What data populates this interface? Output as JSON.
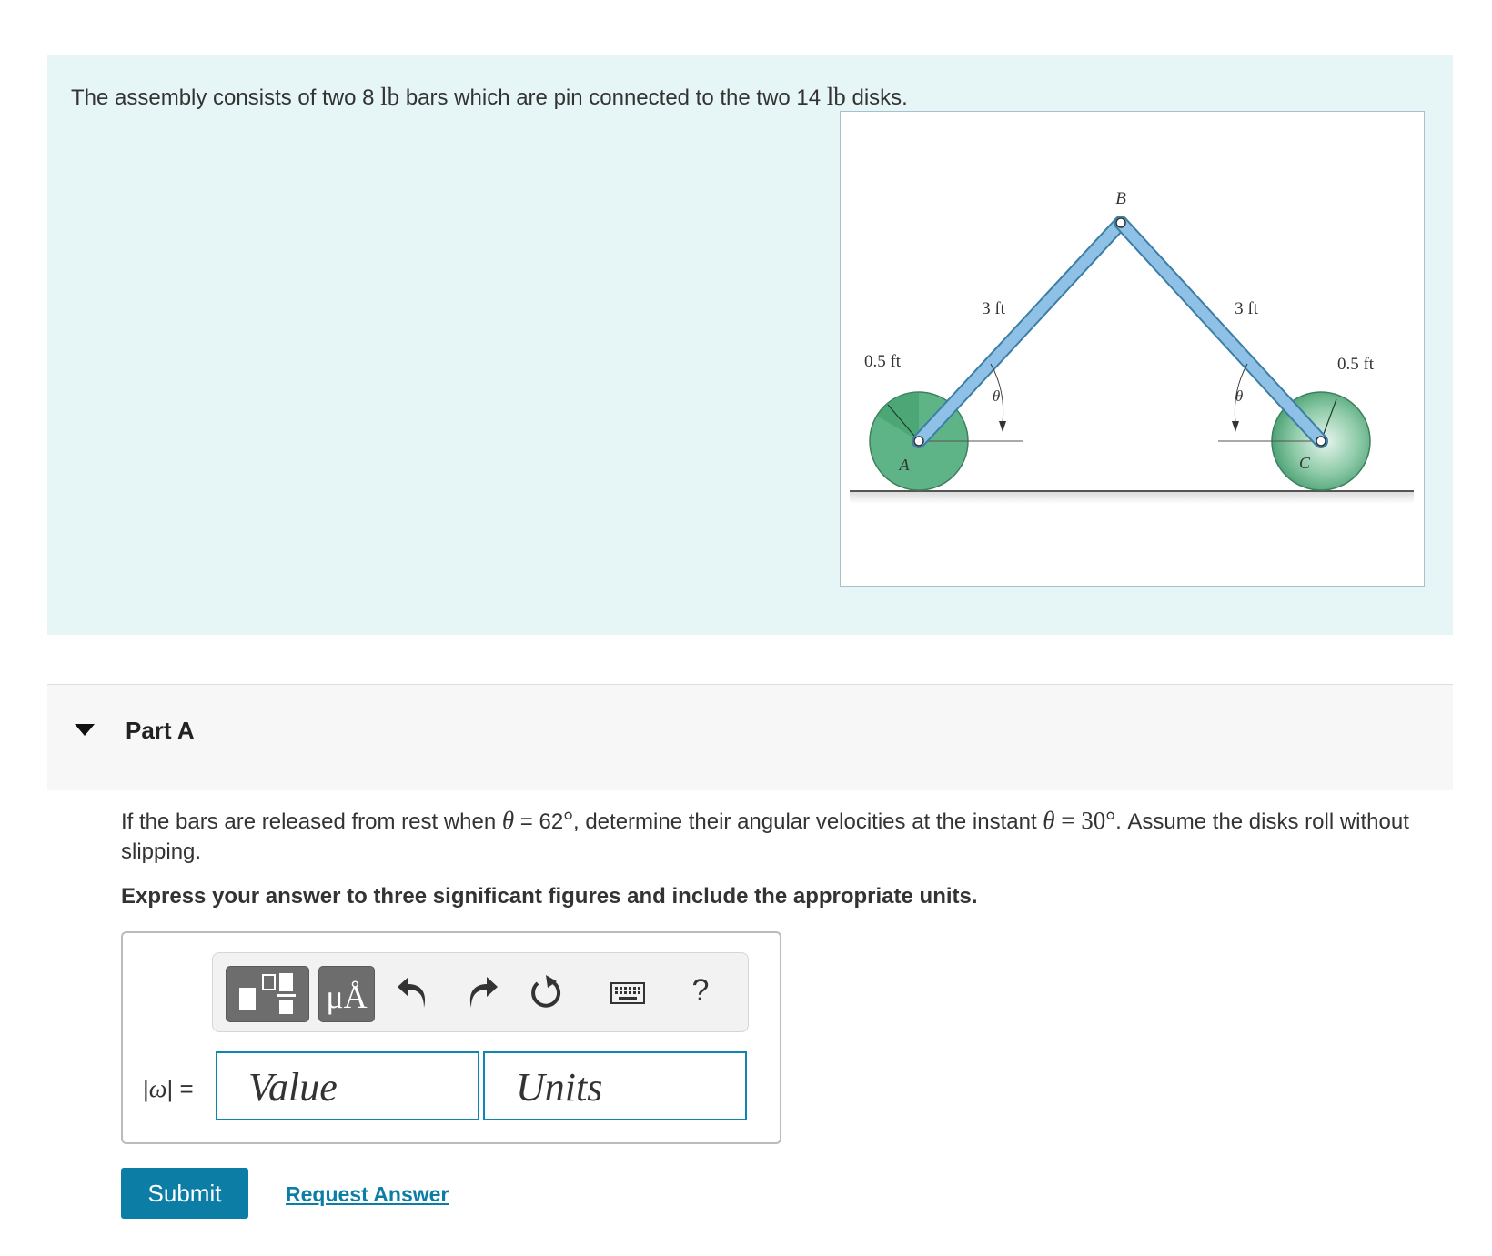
{
  "problem": {
    "intro_before_bar_weight": "The assembly consists of two 8 ",
    "bar_weight_unit": "lb",
    "intro_middle": " bars which are pin connected to the two 14 ",
    "disk_weight_unit": "lb",
    "intro_end": " disks.",
    "figure": {
      "label_B": "B",
      "label_A": "A",
      "label_C": "C",
      "label_bar_left_length": "3 ft",
      "label_bar_right_length": "3 ft",
      "label_disk_left_radius": "0.5 ft",
      "label_disk_right_radius": "0.5 ft",
      "label_theta_left": "θ",
      "label_theta_right": "θ",
      "bar_color": "#8fc1e6",
      "disk_color": "#5fb487"
    }
  },
  "part": {
    "title": "Part A",
    "question_pre": "If the bars are released from rest when ",
    "theta_symbol": "θ",
    "initial_angle": " = 62",
    "degree": "°",
    "question_mid": ", determine their angular velocities at the instant ",
    "final_angle": " = 30°",
    "question_end": ". Assume the disks roll without slipping.",
    "instruction": "Express your answer to three significant figures and include the appropriate units."
  },
  "answer": {
    "toolbar": {
      "templates_icon": "fraction-template-icon",
      "units_label": "μÅ",
      "undo_icon": "undo-icon",
      "redo_icon": "redo-icon",
      "reset_icon": "reset-icon",
      "keyboard_icon": "keyboard-icon",
      "help_label": "?"
    },
    "label_bar_open": "|",
    "label_symbol": "ω",
    "label_bar_close": "| =",
    "value_placeholder": "Value",
    "units_placeholder": "Units"
  },
  "actions": {
    "submit_label": "Submit",
    "request_label": "Request Answer"
  },
  "colors": {
    "problem_bg": "#e6f6f6",
    "accent": "#0c7ea6",
    "input_border": "#0f86b0"
  }
}
